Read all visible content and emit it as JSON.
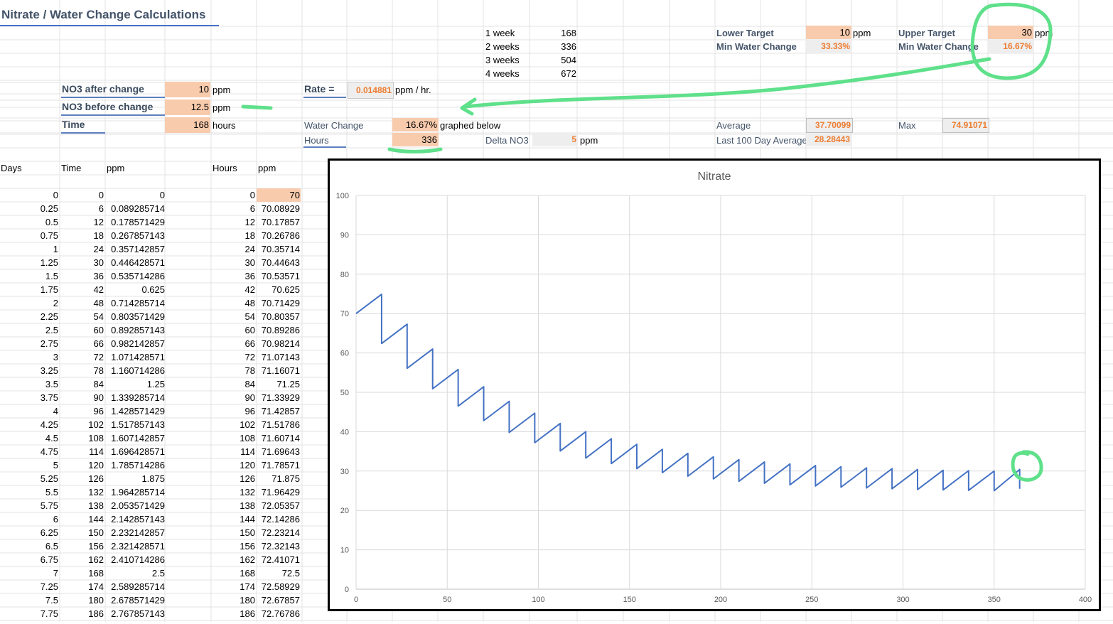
{
  "title": "Nitrate / Water Change Calculations",
  "weeks": [
    {
      "label": "1 week",
      "hours": "168"
    },
    {
      "label": "2 weeks",
      "hours": "336"
    },
    {
      "label": "3 weeks",
      "hours": "504"
    },
    {
      "label": "4 weeks",
      "hours": "672"
    }
  ],
  "targets": {
    "lower_label": "Lower Target",
    "lower_value": "10",
    "lower_unit": "ppm",
    "upper_label": "Upper Target",
    "upper_value": "30",
    "upper_unit": "ppm",
    "min_wc_label": "Min Water Change",
    "min_wc_lower": "33.33%",
    "min_wc_upper": "16.67%"
  },
  "inputs": {
    "after_label": "NO3 after change",
    "after_value": "10",
    "after_unit": "ppm",
    "before_label": "NO3 before change",
    "before_value": "12.5",
    "before_unit": "ppm",
    "time_label": "Time",
    "time_value": "168",
    "time_unit": "hours"
  },
  "rate": {
    "label": "Rate =",
    "value": "0.014881",
    "unit": "ppm / hr."
  },
  "water_change": {
    "label": "Water Change",
    "value": "16.67%",
    "note": "graphed below"
  },
  "hours": {
    "label": "Hours",
    "value": "336"
  },
  "delta": {
    "label": "Delta NO3",
    "value": "5",
    "unit": "ppm"
  },
  "stats": {
    "average_label": "Average",
    "average_value": "37.70099",
    "last100_label": "Last 100 Day Average",
    "last100_value": "28.28443",
    "max_label": "Max",
    "max_value": "74.91071"
  },
  "table_headers": {
    "days": "Days",
    "time": "Time",
    "ppm": "ppm",
    "hours": "Hours",
    "ppm2": "ppm"
  },
  "table_rows": [
    [
      "0",
      "0",
      "0",
      "0",
      "70"
    ],
    [
      "0.25",
      "6",
      "0.089285714",
      "6",
      "70.08929"
    ],
    [
      "0.5",
      "12",
      "0.178571429",
      "12",
      "70.17857"
    ],
    [
      "0.75",
      "18",
      "0.267857143",
      "18",
      "70.26786"
    ],
    [
      "1",
      "24",
      "0.357142857",
      "24",
      "70.35714"
    ],
    [
      "1.25",
      "30",
      "0.446428571",
      "30",
      "70.44643"
    ],
    [
      "1.5",
      "36",
      "0.535714286",
      "36",
      "70.53571"
    ],
    [
      "1.75",
      "42",
      "0.625",
      "42",
      "70.625"
    ],
    [
      "2",
      "48",
      "0.714285714",
      "48",
      "70.71429"
    ],
    [
      "2.25",
      "54",
      "0.803571429",
      "54",
      "70.80357"
    ],
    [
      "2.5",
      "60",
      "0.892857143",
      "60",
      "70.89286"
    ],
    [
      "2.75",
      "66",
      "0.982142857",
      "66",
      "70.98214"
    ],
    [
      "3",
      "72",
      "1.071428571",
      "72",
      "71.07143"
    ],
    [
      "3.25",
      "78",
      "1.160714286",
      "78",
      "71.16071"
    ],
    [
      "3.5",
      "84",
      "1.25",
      "84",
      "71.25"
    ],
    [
      "3.75",
      "90",
      "1.339285714",
      "90",
      "71.33929"
    ],
    [
      "4",
      "96",
      "1.428571429",
      "96",
      "71.42857"
    ],
    [
      "4.25",
      "102",
      "1.517857143",
      "102",
      "71.51786"
    ],
    [
      "4.5",
      "108",
      "1.607142857",
      "108",
      "71.60714"
    ],
    [
      "4.75",
      "114",
      "1.696428571",
      "114",
      "71.69643"
    ],
    [
      "5",
      "120",
      "1.785714286",
      "120",
      "71.78571"
    ],
    [
      "5.25",
      "126",
      "1.875",
      "126",
      "71.875"
    ],
    [
      "5.5",
      "132",
      "1.964285714",
      "132",
      "71.96429"
    ],
    [
      "5.75",
      "138",
      "2.053571429",
      "138",
      "72.05357"
    ],
    [
      "6",
      "144",
      "2.142857143",
      "144",
      "72.14286"
    ],
    [
      "6.25",
      "150",
      "2.232142857",
      "150",
      "72.23214"
    ],
    [
      "6.5",
      "156",
      "2.321428571",
      "156",
      "72.32143"
    ],
    [
      "6.75",
      "162",
      "2.410714286",
      "162",
      "72.41071"
    ],
    [
      "7",
      "168",
      "2.5",
      "168",
      "72.5"
    ],
    [
      "7.25",
      "174",
      "2.589285714",
      "174",
      "72.58929"
    ],
    [
      "7.5",
      "180",
      "2.678571429",
      "180",
      "72.67857"
    ],
    [
      "7.75",
      "186",
      "2.767857143",
      "186",
      "72.76786"
    ]
  ],
  "chart_data": {
    "type": "line",
    "title": "Nitrate",
    "xlim": [
      0,
      400
    ],
    "ylim": [
      0,
      100
    ],
    "x_ticks": [
      0,
      50,
      100,
      150,
      200,
      250,
      300,
      350,
      400
    ],
    "y_ticks": [
      0,
      10,
      20,
      30,
      40,
      50,
      60,
      70,
      80,
      90,
      100
    ],
    "grid": true,
    "line_color": "#4472c4",
    "series": [
      {
        "points": [
          [
            0,
            70
          ],
          [
            14,
            74.9
          ],
          [
            14,
            62.4
          ],
          [
            28,
            67.3
          ],
          [
            28,
            56.1
          ],
          [
            42,
            61
          ],
          [
            42,
            50.9
          ],
          [
            56,
            55.8
          ],
          [
            56,
            46.5
          ],
          [
            70,
            51.4
          ],
          [
            70,
            42.8
          ],
          [
            84,
            47.7
          ],
          [
            84,
            39.8
          ],
          [
            98,
            44.7
          ],
          [
            98,
            37.2
          ],
          [
            112,
            42.1
          ],
          [
            112,
            35.1
          ],
          [
            126,
            40
          ],
          [
            126,
            33.3
          ],
          [
            140,
            38.2
          ],
          [
            140,
            31.9
          ],
          [
            154,
            36.8
          ],
          [
            154,
            30.6
          ],
          [
            168,
            35.5
          ],
          [
            168,
            29.6
          ],
          [
            182,
            34.5
          ],
          [
            182,
            28.7
          ],
          [
            196,
            33.6
          ],
          [
            196,
            28
          ],
          [
            210,
            32.9
          ],
          [
            210,
            27.4
          ],
          [
            224,
            32.3
          ],
          [
            224,
            26.9
          ],
          [
            238,
            31.8
          ],
          [
            238,
            26.5
          ],
          [
            252,
            31.4
          ],
          [
            252,
            26.2
          ],
          [
            266,
            31.1
          ],
          [
            266,
            25.9
          ],
          [
            280,
            30.8
          ],
          [
            280,
            25.7
          ],
          [
            294,
            30.6
          ],
          [
            294,
            25.5
          ],
          [
            308,
            30.4
          ],
          [
            308,
            25.3
          ],
          [
            322,
            30.2
          ],
          [
            322,
            25.2
          ],
          [
            336,
            30.1
          ],
          [
            336,
            25.1
          ],
          [
            350,
            30
          ],
          [
            350,
            25
          ],
          [
            364,
            30.4
          ],
          [
            364,
            25.5
          ]
        ]
      }
    ]
  }
}
